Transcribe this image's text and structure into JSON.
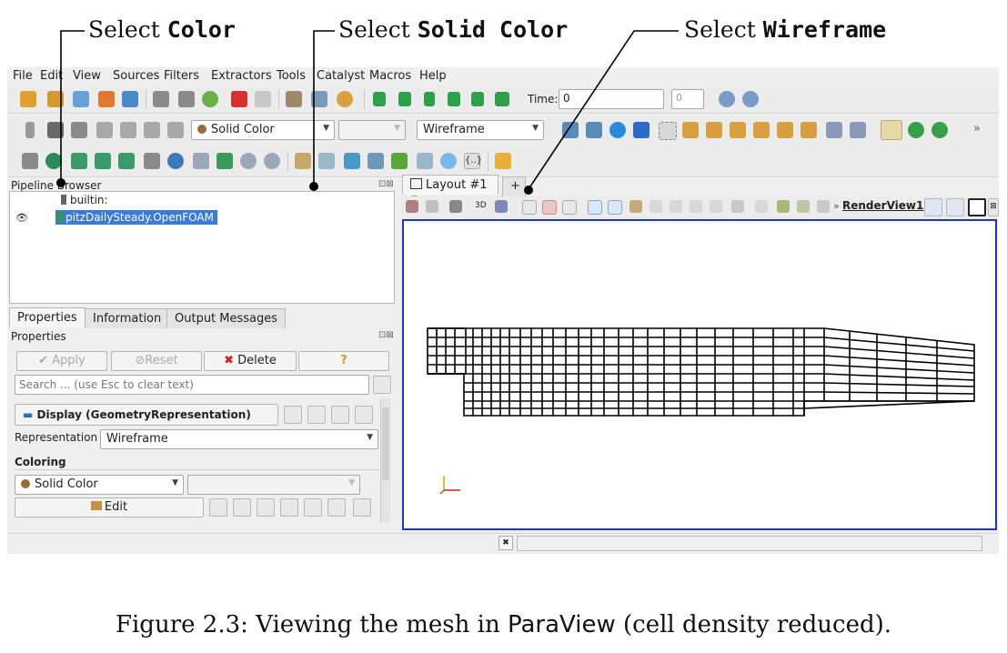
{
  "annotations": [
    {
      "prefix": "Select",
      "keyword": "Color"
    },
    {
      "prefix": "Select",
      "keyword": "Solid Color"
    },
    {
      "prefix": "Select",
      "keyword": "Wireframe"
    }
  ],
  "menu": [
    "File",
    "Edit",
    "View",
    "Sources",
    "Filters",
    "Extractors",
    "Tools",
    "Catalyst",
    "Macros",
    "Help"
  ],
  "toolbar": {
    "time_label": "Time:",
    "time_value": "0",
    "time_index": "0",
    "color_mode": "Solid Color",
    "representation": "Wireframe"
  },
  "pipeline": {
    "title": "Pipeline Browser",
    "root": "builtin:",
    "source": "pitzDailySteady.OpenFOAM"
  },
  "left_tabs": [
    "Properties",
    "Information",
    "Output Messages"
  ],
  "properties": {
    "title": "Properties",
    "apply": "Apply",
    "reset": "Reset",
    "delete": "Delete",
    "help": "?",
    "search_placeholder": "Search ... (use Esc to clear text)",
    "display_section": "Display (GeometryRepresentation)",
    "representation_label": "Representation",
    "representation_value": "Wireframe",
    "coloring_label": "Coloring",
    "coloring_value": "Solid Color",
    "edit": "Edit"
  },
  "view": {
    "layout_tab": "Layout #1",
    "add_tab": "+",
    "view_name": "RenderView1",
    "three_d": "3D"
  },
  "caption": {
    "prefix": "Figure 2.3: Viewing the mesh in ",
    "app": "ParaView",
    "suffix": " (cell density reduced)."
  },
  "colors": {
    "selection": "#3a7ad8",
    "viewport_border": "#2233cc",
    "mesh": "#000000"
  }
}
